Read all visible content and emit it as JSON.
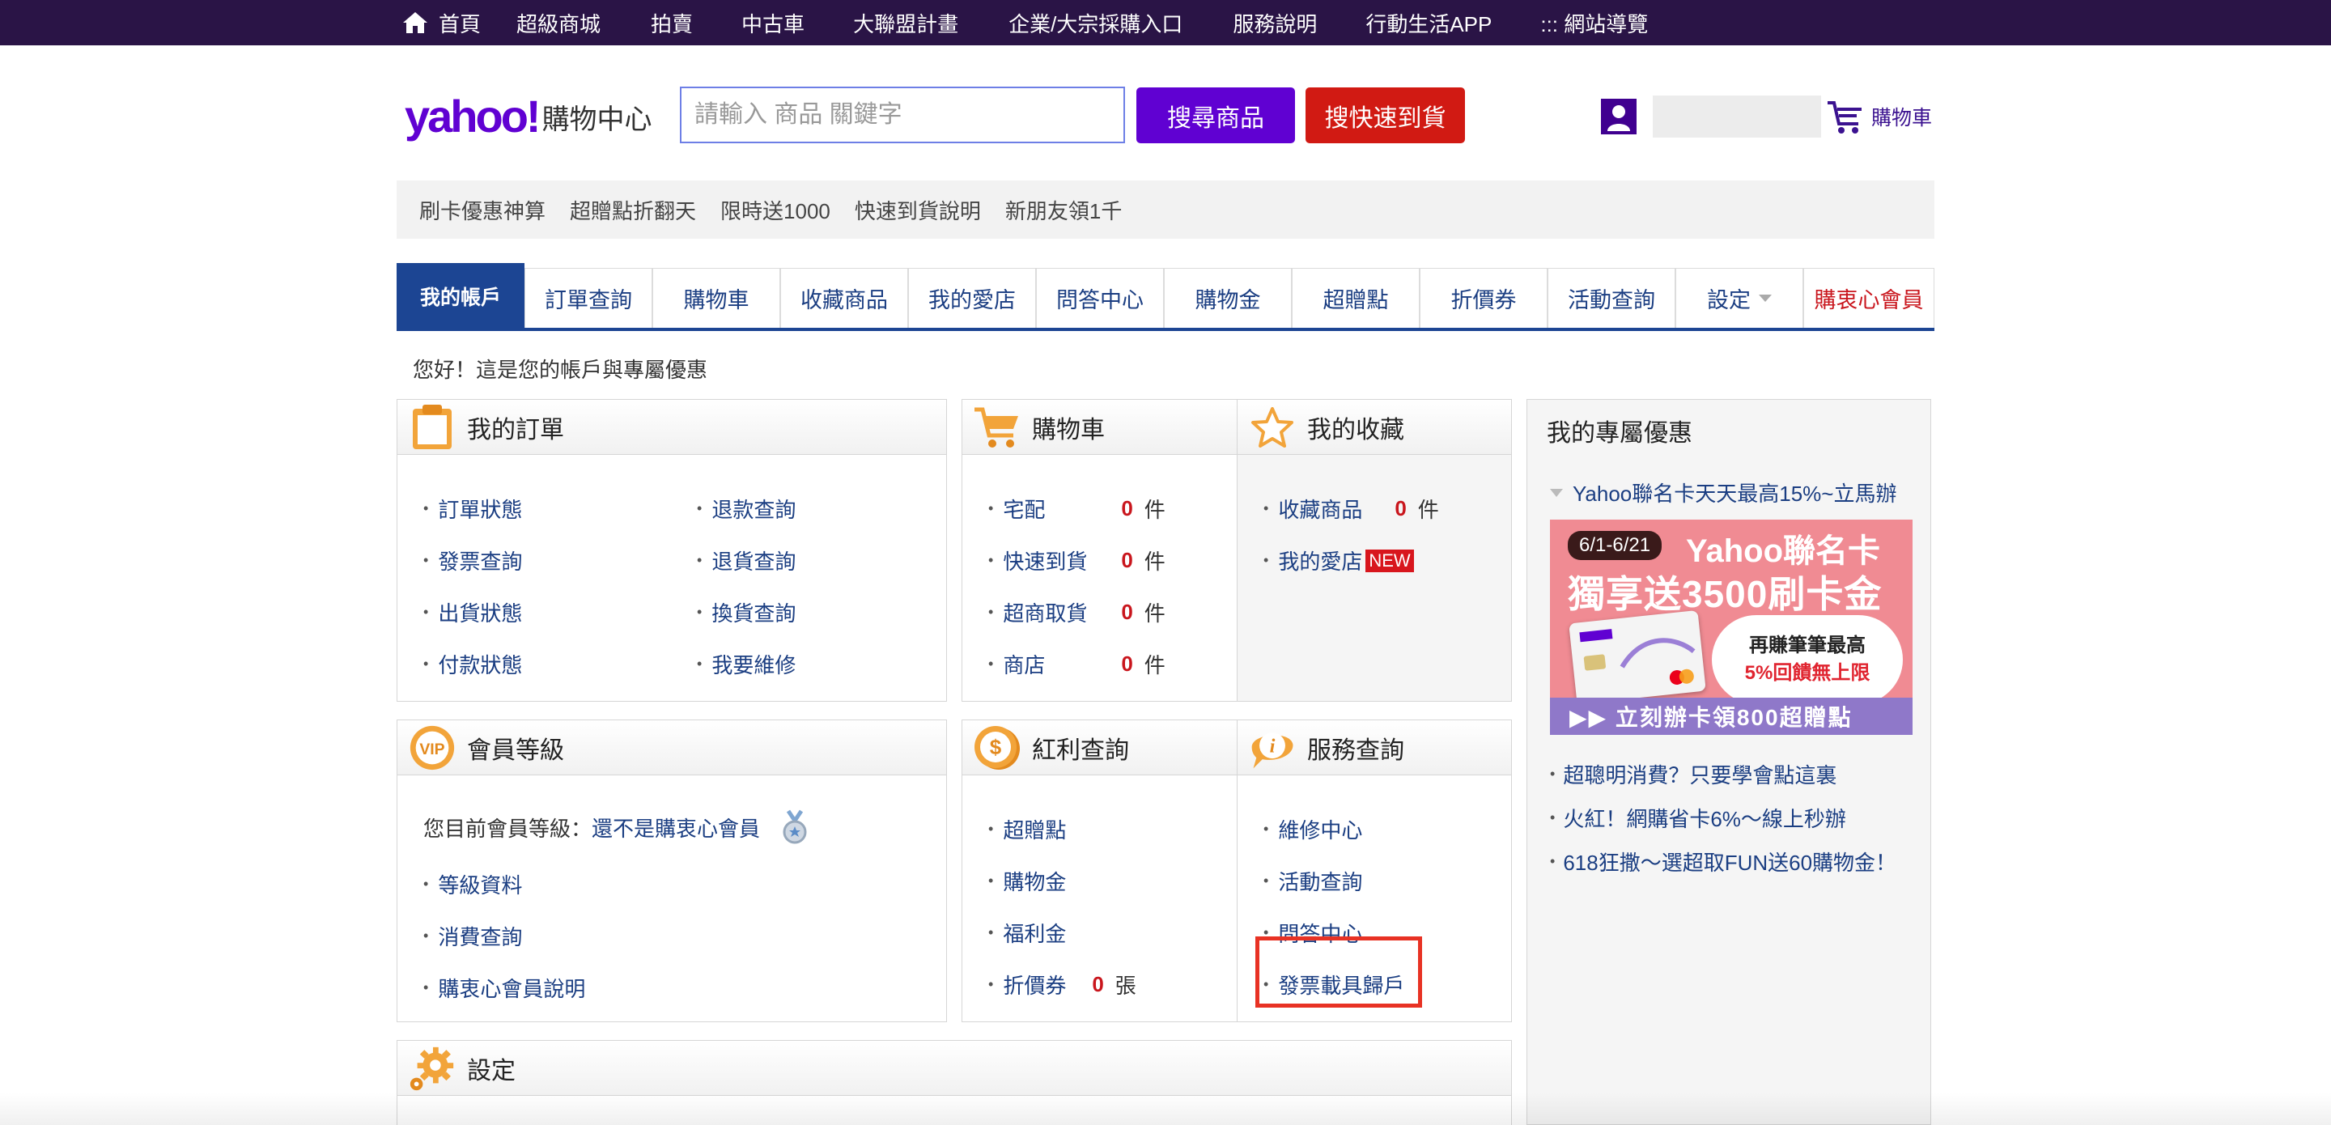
{
  "topnav": [
    "首頁",
    "超級商城",
    "拍賣",
    "中古車",
    "大聯盟計畫",
    "企業/大宗採購入口",
    "服務說明",
    "行動生活APP",
    "::: 網站導覽"
  ],
  "header": {
    "logo_main": "yahoo!",
    "logo_sub": "購物中心",
    "search_placeholder": "請輸入 商品 關鍵字",
    "search_button": "搜尋商品",
    "fast_button": "搜快速到貨",
    "cart_label": "購物車"
  },
  "promo_links": [
    "刷卡優惠神算",
    "超贈點折翻天",
    "限時送1000",
    "快速到貨說明",
    "新朋友領1千"
  ],
  "tabs": [
    "我的帳戶",
    "訂單查詢",
    "購物車",
    "收藏商品",
    "我的愛店",
    "問答中心",
    "購物金",
    "超贈點",
    "折價券",
    "活動查詢",
    "設定",
    "購衷心會員"
  ],
  "greeting": "您好！這是您的帳戶與專屬優惠",
  "orders": {
    "title": "我的訂單",
    "left": [
      "訂單狀態",
      "發票查詢",
      "出貨狀態",
      "付款狀態"
    ],
    "right": [
      "退款查詢",
      "退貨查詢",
      "換貨查詢",
      "我要維修"
    ]
  },
  "cart": {
    "title": "購物車",
    "items": [
      {
        "label": "宅配",
        "count": "0",
        "unit": "件"
      },
      {
        "label": "快速到貨",
        "count": "0",
        "unit": "件"
      },
      {
        "label": "超商取貨",
        "count": "0",
        "unit": "件"
      },
      {
        "label": "商店",
        "count": "0",
        "unit": "件"
      }
    ]
  },
  "favorites": {
    "title": "我的收藏",
    "item1": {
      "label": "收藏商品",
      "count": "0",
      "unit": "件"
    },
    "item2": {
      "label": "我的愛店",
      "badge": "NEW"
    }
  },
  "member": {
    "title": "會員等級",
    "level_prefix": "您目前會員等級：",
    "level_value": "還不是購衷心會員",
    "links": [
      "等級資料",
      "消費查詢",
      "購衷心會員說明"
    ]
  },
  "bonus": {
    "title": "紅利查詢",
    "links": [
      "超贈點",
      "購物金",
      "福利金"
    ],
    "coupon": {
      "label": "折價券",
      "count": "0",
      "unit": "張"
    }
  },
  "service": {
    "title": "服務查詢",
    "links": [
      "維修中心",
      "活動查詢",
      "問答中心",
      "發票載具歸戶"
    ]
  },
  "settings": {
    "title": "設定"
  },
  "exclusive": {
    "title": "我的專屬優惠",
    "subtitle": "Yahoo聯名卡天天最高15%~立馬辦",
    "banner": {
      "date": "6/1-6/21",
      "title": "Yahoo聯名卡",
      "main": "獨享送3500刷卡金",
      "bubble_line1": "再賺筆筆最高",
      "bubble_line2": "5%回饋無上限",
      "bottom": "▶▶ 立刻辦卡領800超贈點"
    },
    "links": [
      "超聰明消費？只要學會點這裏",
      "火紅！網購省卡6%～線上秒辦",
      "618狂撒～選超取FUN送60購物金！"
    ]
  },
  "colors": {
    "topbar": "#2a1446",
    "brand": "#6001d2",
    "red_button": "#d11a13",
    "tab_active": "#1c4593",
    "link": "#1b3e82",
    "highlight": "#e83224"
  }
}
